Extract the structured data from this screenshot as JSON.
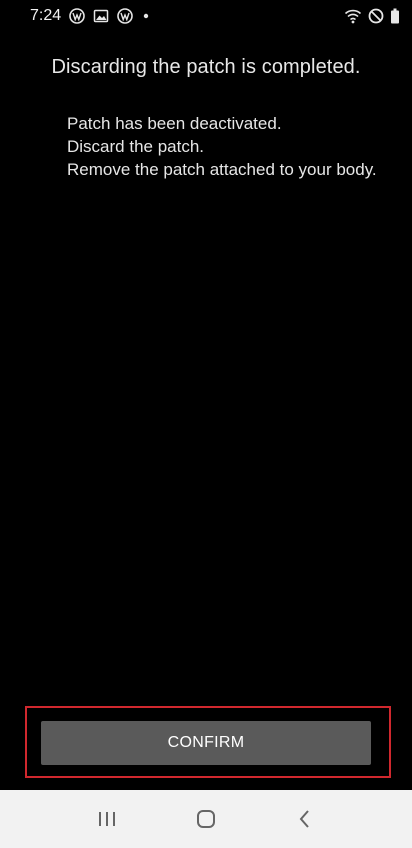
{
  "status_bar": {
    "time": "7:24",
    "icons": [
      "wordpress-icon",
      "image-icon",
      "wordpress-icon",
      "dot-icon",
      "wifi-icon",
      "do-not-disturb-icon",
      "battery-icon"
    ]
  },
  "screen": {
    "title": "Discarding the patch is completed.",
    "message_lines": [
      "Patch has been deactivated.",
      "Discard the patch.",
      "Remove the patch attached to your body."
    ]
  },
  "actions": {
    "confirm_label": "CONFIRM"
  },
  "nav_bar": {
    "buttons": [
      "recent-apps-icon",
      "home-icon",
      "back-icon"
    ]
  },
  "colors": {
    "background": "#000000",
    "button_bg": "#5a5a5a",
    "highlight_border": "#d0282e",
    "nav_bg": "#f2f2f2"
  }
}
